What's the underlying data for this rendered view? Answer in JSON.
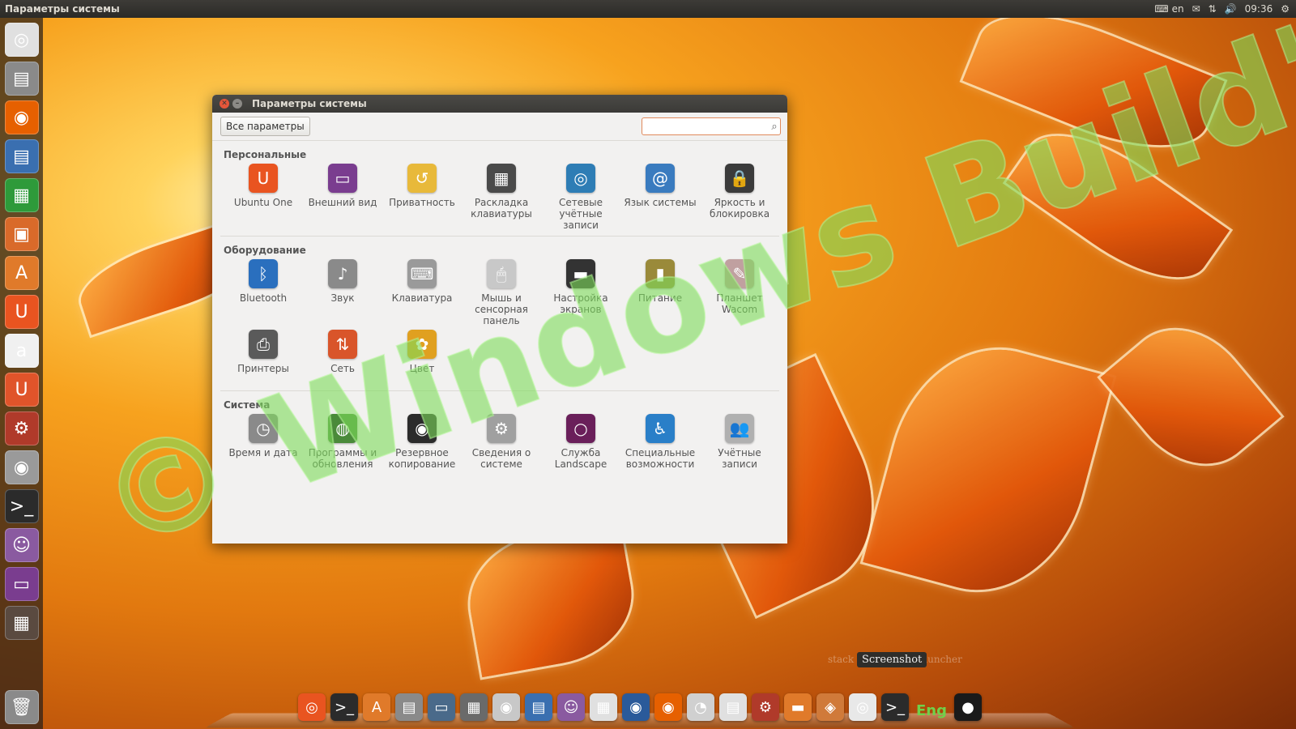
{
  "top_panel": {
    "title": "Параметры системы",
    "keyboard_layout": "en",
    "time": "09:36"
  },
  "window": {
    "title": "Параметры системы",
    "all_settings_label": "Все параметры",
    "search_placeholder": ""
  },
  "sections": {
    "personal": {
      "title": "Персональные",
      "items": [
        {
          "label": "Ubuntu One",
          "icon": "ubuntu-one-icon",
          "color": "#e95420",
          "glyph": "U"
        },
        {
          "label": "Внешний вид",
          "icon": "appearance-icon",
          "color": "#7a3d8f",
          "glyph": "▭"
        },
        {
          "label": "Приватность",
          "icon": "privacy-icon",
          "color": "#e8b93a",
          "glyph": "↺"
        },
        {
          "label": "Раскладка клавиатуры",
          "icon": "workspaces-icon",
          "color": "#4a4a4a",
          "glyph": "▦"
        },
        {
          "label": "Сетевые учётные записи",
          "icon": "online-accounts-icon",
          "color": "#2e7db5",
          "glyph": "◎"
        },
        {
          "label": "Язык системы",
          "icon": "language-icon",
          "color": "#3a7bbf",
          "glyph": "@"
        },
        {
          "label": "Яркость и блокировка",
          "icon": "lock-icon",
          "color": "#3b3b3b",
          "glyph": "🔒"
        }
      ]
    },
    "hardware": {
      "title": "Оборудование",
      "items": [
        {
          "label": "Bluetooth",
          "icon": "bluetooth-icon",
          "color": "#2a6fbe",
          "glyph": "ᛒ"
        },
        {
          "label": "Звук",
          "icon": "sound-icon",
          "color": "#8a8a8a",
          "glyph": "♪"
        },
        {
          "label": "Клавиатура",
          "icon": "keyboard-icon",
          "color": "#9a9a9a",
          "glyph": "⌨"
        },
        {
          "label": "Мышь и сенсорная панель",
          "icon": "mouse-icon",
          "color": "#c8c8c8",
          "glyph": "🖱"
        },
        {
          "label": "Настройка экранов",
          "icon": "display-icon",
          "color": "#333333",
          "glyph": "▬"
        },
        {
          "label": "Питание",
          "icon": "power-icon",
          "color": "#9a8a3a",
          "glyph": "▮"
        },
        {
          "label": "Планшет Wacom",
          "icon": "wacom-icon",
          "color": "#c0a0a0",
          "glyph": "✎"
        },
        {
          "label": "Принтеры",
          "icon": "printer-icon",
          "color": "#5a5a5a",
          "glyph": "⎙"
        },
        {
          "label": "Сеть",
          "icon": "network-icon",
          "color": "#d9552a",
          "glyph": "⇅"
        },
        {
          "label": "Цвет",
          "icon": "color-icon",
          "color": "#e0a020",
          "glyph": "✿"
        }
      ]
    },
    "system": {
      "title": "Система",
      "items": [
        {
          "label": "Время и дата",
          "icon": "clock-icon",
          "color": "#8a8a8a",
          "glyph": "◷"
        },
        {
          "label": "Программы и обновления",
          "icon": "software-updates-icon",
          "color": "#4a8a3a",
          "glyph": "◍"
        },
        {
          "label": "Резервное копирование",
          "icon": "backup-icon",
          "color": "#2b2b2b",
          "glyph": "◉"
        },
        {
          "label": "Сведения о системе",
          "icon": "gear-icon",
          "color": "#a0a0a0",
          "glyph": "⚙"
        },
        {
          "label": "Служба Landscape",
          "icon": "landscape-icon",
          "color": "#6a1f5a",
          "glyph": "○"
        },
        {
          "label": "Специальные возможности",
          "icon": "accessibility-icon",
          "color": "#2a7fc8",
          "glyph": "♿"
        },
        {
          "label": "Учётные записи",
          "icon": "user-accounts-icon",
          "color": "#b0b0b0",
          "glyph": "👥"
        }
      ]
    }
  },
  "launcher": [
    {
      "name": "dash-home-icon",
      "color": "#e0e0e0",
      "glyph": "◎"
    },
    {
      "name": "files-icon",
      "color": "#8a8a8a",
      "glyph": "▤"
    },
    {
      "name": "firefox-icon",
      "color": "#e66000",
      "glyph": "◉"
    },
    {
      "name": "writer-icon",
      "color": "#3a6fb0",
      "glyph": "▤"
    },
    {
      "name": "calc-icon",
      "color": "#2e9a3a",
      "glyph": "▦"
    },
    {
      "name": "impress-icon",
      "color": "#d96a2a",
      "glyph": "▣"
    },
    {
      "name": "software-center-icon",
      "color": "#e07a2a",
      "glyph": "A"
    },
    {
      "name": "ubuntu-one-icon",
      "color": "#e95420",
      "glyph": "U"
    },
    {
      "name": "amazon-icon",
      "color": "#f0f0f0",
      "glyph": "a"
    },
    {
      "name": "ubuntu-one-music-icon",
      "color": "#e0542a",
      "glyph": "U"
    },
    {
      "name": "system-settings-icon",
      "color": "#b03a2a",
      "glyph": "⚙"
    },
    {
      "name": "disk-icon",
      "color": "#9a9a9a",
      "glyph": "◉"
    },
    {
      "name": "terminal-icon",
      "color": "#2b2b2b",
      "glyph": ">_"
    },
    {
      "name": "pidgin-icon",
      "color": "#8a5aa0",
      "glyph": "☺"
    },
    {
      "name": "media-icon",
      "color": "#7a3d8f",
      "glyph": "▭"
    },
    {
      "name": "workspace-switcher-icon",
      "color": "#5a4a40",
      "glyph": "▦"
    }
  ],
  "dock": [
    {
      "name": "ubuntu-icon",
      "color": "#e95420",
      "glyph": "◎"
    },
    {
      "name": "terminal-icon",
      "color": "#2b2b2b",
      "glyph": ">_"
    },
    {
      "name": "software-center-icon",
      "color": "#e07a2a",
      "glyph": "A"
    },
    {
      "name": "files-icon",
      "color": "#8a8a8a",
      "glyph": "▤"
    },
    {
      "name": "monitor-icon",
      "color": "#4a6a8a",
      "glyph": "▭"
    },
    {
      "name": "calculator-icon",
      "color": "#6a6a6a",
      "glyph": "▦"
    },
    {
      "name": "cd-icon",
      "color": "#c8c8c8",
      "glyph": "◉"
    },
    {
      "name": "document-icon",
      "color": "#3a6fb0",
      "glyph": "▤"
    },
    {
      "name": "pidgin-icon",
      "color": "#8a5aa0",
      "glyph": "☺"
    },
    {
      "name": "spreadsheet-icon",
      "color": "#e0e0e0",
      "glyph": "▦"
    },
    {
      "name": "thunderbird-icon",
      "color": "#2a5a9a",
      "glyph": "◉"
    },
    {
      "name": "firefox-icon",
      "color": "#e66000",
      "glyph": "◉"
    },
    {
      "name": "chat-icon",
      "color": "#d0d0d0",
      "glyph": "◔"
    },
    {
      "name": "calendar-icon",
      "color": "#e0e0e0",
      "glyph": "▤"
    },
    {
      "name": "settings-icon",
      "color": "#b03a2a",
      "glyph": "⚙"
    },
    {
      "name": "folder-icon",
      "color": "#e07a2a",
      "glyph": "▬"
    },
    {
      "name": "image-viewer-icon",
      "color": "#d07a3a",
      "glyph": "◈"
    },
    {
      "name": "screenshot-icon",
      "color": "#e8e8e8",
      "glyph": "◎"
    },
    {
      "name": "terminal2-icon",
      "color": "#2b2b2b",
      "glyph": ">_"
    },
    {
      "name": "power-icon",
      "color": "#1a1a1a",
      "glyph": "●"
    }
  ],
  "dock_tooltip": "Screenshot",
  "dock_ghost_labels": [
    "stack",
    "Launcher"
  ],
  "dock_lang": "Eng",
  "watermark": {
    "text": "© Windows Build's",
    "color": "#7ddc5a"
  }
}
